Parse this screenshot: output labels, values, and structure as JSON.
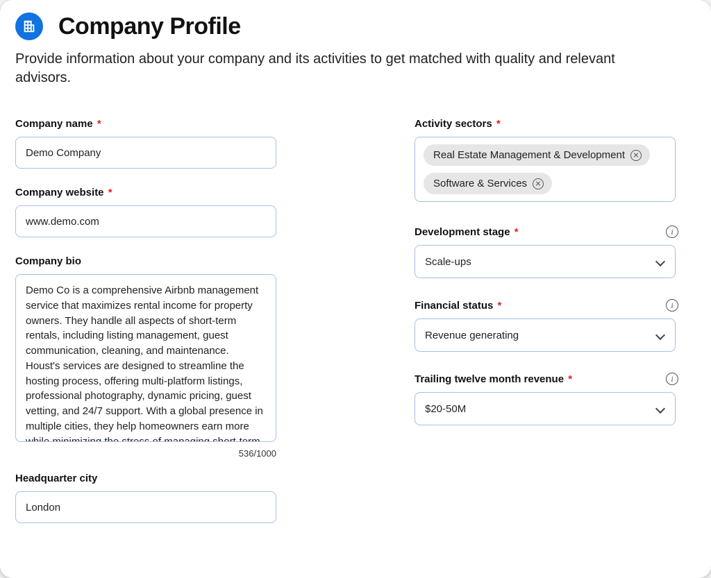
{
  "header": {
    "title": "Company Profile",
    "subtitle": "Provide information about your company and its activities to get matched with quality and relevant advisors."
  },
  "left": {
    "company_name": {
      "label": "Company name",
      "value": "Demo Company"
    },
    "website": {
      "label": "Company website",
      "value": "www.demo.com"
    },
    "bio": {
      "label": "Company bio",
      "value": "Demo Co is a comprehensive Airbnb management service that maximizes rental income for property owners. They handle all aspects of short-term rentals, including listing management, guest communication, cleaning, and maintenance. Houst's services are designed to streamline the hosting process, offering multi-platform listings, professional photography, dynamic pricing, guest vetting, and 24/7 support. With a global presence in multiple cities, they help homeowners earn more while minimizing the stress of managing short-term rentals.",
      "counter": "536/1000"
    },
    "hq": {
      "label": "Headquarter city",
      "value": "London"
    }
  },
  "right": {
    "sectors": {
      "label": "Activity sectors",
      "tags": [
        "Real Estate Management & Development",
        "Software & Services"
      ]
    },
    "stage": {
      "label": "Development stage",
      "value": "Scale-ups"
    },
    "financial": {
      "label": "Financial status",
      "value": "Revenue generating"
    },
    "ttm": {
      "label": "Trailing twelve month revenue",
      "value": "$20-50M"
    }
  }
}
